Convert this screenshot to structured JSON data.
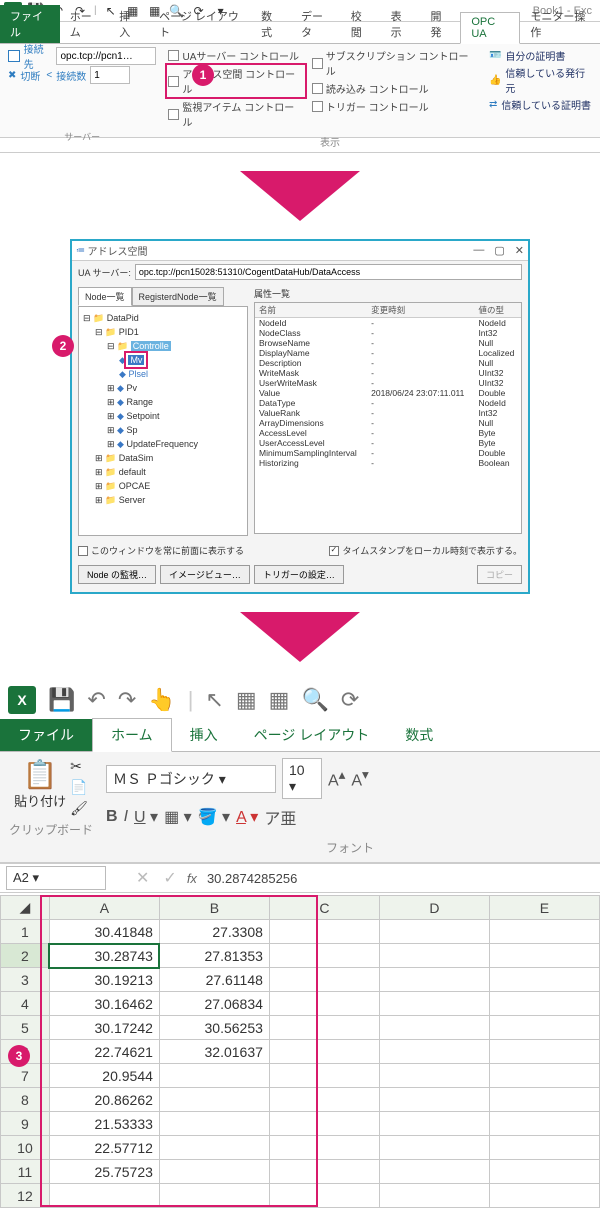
{
  "book_title": "Book1 - Exc",
  "tabs": {
    "file": "ファイル",
    "home": "ホーム",
    "insert": "挿入",
    "layout": "ページ レイアウト",
    "formula": "数式",
    "data": "データ",
    "review": "校閲",
    "view": "表示",
    "dev": "開発",
    "opcua": "OPC UA",
    "monitor": "モニター操作"
  },
  "ribbon": {
    "connect_to": "接続先",
    "connect_url": "opc.tcp://pcn1…",
    "disconnect": "切断",
    "connect_count": "接続数",
    "connect_count_val": "1",
    "server_group": "サーバー",
    "view_group": "表示",
    "ua_server_ctrl": "UAサーバー コントロール",
    "addr_space_ctrl": "アドレス空間 コントロール",
    "monitor_item_ctrl": "監視アイテム コントロール",
    "subscription_ctrl": "サブスクリプション コントロール",
    "read_ctrl": "読み込み コントロール",
    "trigger_ctrl": "トリガー コントロール",
    "self_cert": "自分の証明書",
    "trusted_issuer": "信頼している発行元",
    "trusted_cert": "信頼している証明書"
  },
  "dialog": {
    "title": "アドレス空間",
    "ua_server_label": "UA サーバー:",
    "ua_server_value": "opc.tcp://pcn15028:51310/CogentDataHub/DataAccess",
    "node_list_tab": "Node一覧",
    "reg_node_tab": "RegisterdNode一覧",
    "prop_list_label": "属性一覧",
    "tree": {
      "root": "DataPid",
      "pid1": "PID1",
      "controller": "Controlle",
      "mv": "Mv",
      "plsel": "Plsel",
      "pv": "Pv",
      "range": "Range",
      "setpoint": "Setpoint",
      "sp": "Sp",
      "updatefreq": "UpdateFrequency",
      "datasim": "DataSim",
      "default": "default",
      "opcae": "OPCAE",
      "server": "Server"
    },
    "prop_headers": {
      "name": "名前",
      "changed": "変更時刻",
      "type": "値の型"
    },
    "props": [
      {
        "n": "NodeId",
        "c": "-",
        "t": "NodeId"
      },
      {
        "n": "NodeClass",
        "c": "-",
        "t": "Int32"
      },
      {
        "n": "BrowseName",
        "c": "-",
        "t": "Null"
      },
      {
        "n": "DisplayName",
        "c": "-",
        "t": "Localized"
      },
      {
        "n": "Description",
        "c": "-",
        "t": "Null"
      },
      {
        "n": "WriteMask",
        "c": "-",
        "t": "UInt32"
      },
      {
        "n": "UserWriteMask",
        "c": "-",
        "t": "UInt32"
      },
      {
        "n": "Value",
        "c": "2018/06/24 23:07:11.011",
        "t": "Double"
      },
      {
        "n": "DataType",
        "c": "-",
        "t": "NodeId"
      },
      {
        "n": "ValueRank",
        "c": "-",
        "t": "Int32"
      },
      {
        "n": "ArrayDimensions",
        "c": "-",
        "t": "Null"
      },
      {
        "n": "AccessLevel",
        "c": "-",
        "t": "Byte"
      },
      {
        "n": "UserAccessLevel",
        "c": "-",
        "t": "Byte"
      },
      {
        "n": "MinimumSamplingInterval",
        "c": "-",
        "t": "Double"
      },
      {
        "n": "Historizing",
        "c": "-",
        "t": "Boolean"
      }
    ],
    "always_front": "このウィンドウを常に前面に表示する",
    "timestamp_local": "タイムスタンプをローカル時刻で表示する。",
    "btn_monitor": "Node の監視…",
    "btn_image": "イメージビュー…",
    "btn_trigger": "トリガーの設定…",
    "btn_copy": "コピー"
  },
  "excel3": {
    "tabs": {
      "file": "ファイル",
      "home": "ホーム",
      "insert": "挿入",
      "layout": "ページ レイアウト",
      "formula": "数式"
    },
    "paste": "貼り付け",
    "clipboard": "クリップボード",
    "font_group": "フォント",
    "font_name": "ＭＳ Ｐゴシック",
    "font_size": "10",
    "namebox": "A2",
    "formula": "30.2874285256",
    "cols": [
      "A",
      "B",
      "C",
      "D",
      "E"
    ],
    "chart_data": {
      "type": "table",
      "columns": [
        "A",
        "B"
      ],
      "rows": [
        {
          "r": 1,
          "A": "30.41848",
          "B": "27.3308"
        },
        {
          "r": 2,
          "A": "30.28743",
          "B": "27.81353"
        },
        {
          "r": 3,
          "A": "30.19213",
          "B": "27.61148"
        },
        {
          "r": 4,
          "A": "30.16462",
          "B": "27.06834"
        },
        {
          "r": 5,
          "A": "30.17242",
          "B": "30.56253"
        },
        {
          "r": 6,
          "A": "22.74621",
          "B": "32.01637"
        },
        {
          "r": 7,
          "A": "20.9544",
          "B": ""
        },
        {
          "r": 8,
          "A": "20.86262",
          "B": ""
        },
        {
          "r": 9,
          "A": "21.53333",
          "B": ""
        },
        {
          "r": 10,
          "A": "22.57712",
          "B": ""
        },
        {
          "r": 11,
          "A": "25.75723",
          "B": ""
        },
        {
          "r": 12,
          "A": "",
          "B": ""
        }
      ]
    }
  }
}
